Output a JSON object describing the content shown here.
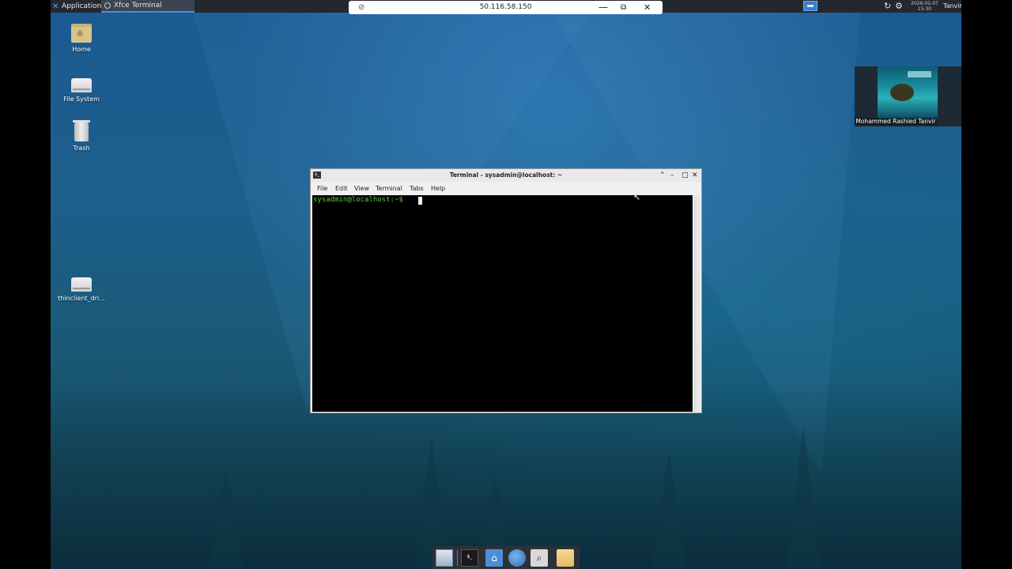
{
  "top_panel": {
    "applications": "Applications",
    "task_label": "Xfce Terminal",
    "clock_date": "2026-02-07",
    "clock_time": "15:30",
    "user": "Tanvir"
  },
  "remote_toolbar": {
    "address": "50.116.58.150",
    "minimize": "—",
    "restore": "⧉",
    "close": "✕"
  },
  "desktop_icons": [
    {
      "label": "Home"
    },
    {
      "label": "File System"
    },
    {
      "label": "Trash"
    },
    {
      "label": "thinclient_dri..."
    }
  ],
  "webcam": {
    "name": "Mohammed Rashied Tanvir"
  },
  "terminal": {
    "title": "Terminal - sysadmin@localhost: ~",
    "menu": [
      "File",
      "Edit",
      "View",
      "Terminal",
      "Tabs",
      "Help"
    ],
    "prompt": "sysadmin@localhost:~$ ",
    "icon_text": "$_"
  },
  "dock": {
    "terminal_text": "$_"
  },
  "icons": {
    "app_menu": "xfce-icon",
    "refresh": "refresh-icon",
    "settings": "gear-icon",
    "pin": "pin-off-icon"
  },
  "colors": {
    "prompt_green": "#5ccd3c",
    "panel": "#23282e",
    "accent": "#4a90d9"
  }
}
